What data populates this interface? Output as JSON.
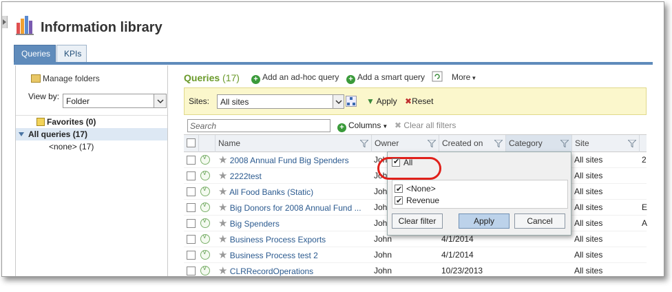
{
  "page": {
    "title": "Information library"
  },
  "tabs": [
    "Queries",
    "KPIs"
  ],
  "left": {
    "manage_folders": "Manage folders",
    "view_by_label": "View by:",
    "view_by_value": "Folder",
    "tree": [
      {
        "label": "Favorites (0)"
      },
      {
        "label": "All queries (17)"
      },
      {
        "label": "<none> (17)"
      }
    ]
  },
  "header": {
    "title": "Queries",
    "count": "(17)",
    "add_adhoc": "Add an ad-hoc query",
    "add_smart": "Add a smart query",
    "more": "More"
  },
  "filter": {
    "sites_label": "Sites:",
    "sites_value": "All sites",
    "apply": "Apply",
    "reset": "Reset"
  },
  "toolbar": {
    "search_placeholder": "Search",
    "columns": "Columns",
    "clear_all": "Clear all filters"
  },
  "columns": [
    "Name",
    "Owner",
    "Created on",
    "Category",
    "Site"
  ],
  "rows": [
    {
      "name": "2008 Annual Fund Big Spenders",
      "owner": "John",
      "created": "",
      "site": "All sites",
      "extra": "2"
    },
    {
      "name": "2222test",
      "owner": "John",
      "created": "",
      "site": "All sites",
      "extra": ""
    },
    {
      "name": "All Food Banks (Static)",
      "owner": "John",
      "created": "",
      "site": "All sites",
      "extra": ""
    },
    {
      "name": "Big Donors for 2008 Annual Fund ...",
      "owner": "John",
      "created": "",
      "site": "All sites",
      "extra": "E"
    },
    {
      "name": "Big Spenders",
      "owner": "John",
      "created": "",
      "site": "All sites",
      "extra": "A"
    },
    {
      "name": "Business Process Exports",
      "owner": "John",
      "created": "4/1/2014",
      "site": "All sites",
      "extra": ""
    },
    {
      "name": "Business Process test 2",
      "owner": "John",
      "created": "4/1/2014",
      "site": "All sites",
      "extra": ""
    },
    {
      "name": "CLRRecordOperations",
      "owner": "John",
      "created": "10/23/2013",
      "site": "All sites",
      "extra": ""
    }
  ],
  "popup": {
    "all_label": "All",
    "options": [
      "<None>",
      "Revenue"
    ],
    "clear_filter": "Clear filter",
    "apply": "Apply",
    "cancel": "Cancel"
  }
}
